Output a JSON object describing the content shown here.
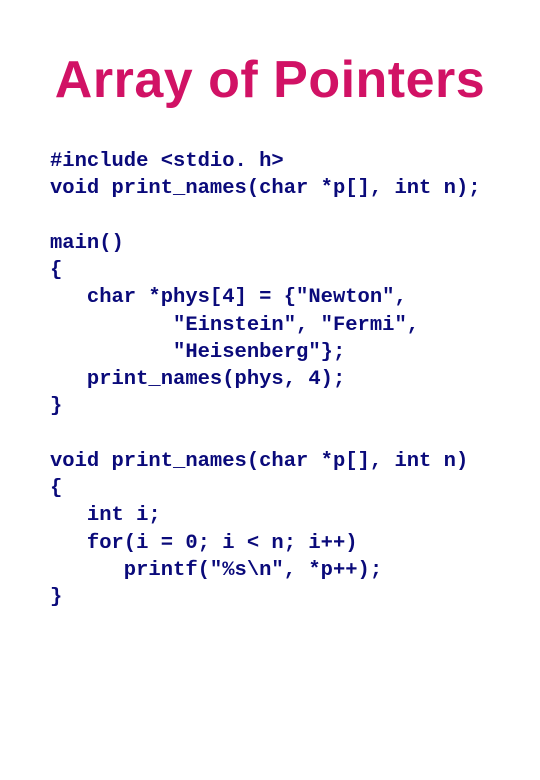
{
  "title": "Array of Pointers",
  "code": {
    "l01": "#include <stdio. h>",
    "l02": "void print_names(char *p[], int n);",
    "l03": "",
    "l04": "main()",
    "l05": "{",
    "l06": "   char *phys[4] = {\"Newton\",",
    "l07": "          \"Einstein\", \"Fermi\",",
    "l08": "          \"Heisenberg\"};",
    "l09": "   print_names(phys, 4);",
    "l10": "}",
    "l11": "",
    "l12": "void print_names(char *p[], int n)",
    "l13": "{",
    "l14": "   int i;",
    "l15": "   for(i = 0; i < n; i++)",
    "l16": "      printf(\"%s\\n\", *p++);",
    "l17": "}"
  }
}
